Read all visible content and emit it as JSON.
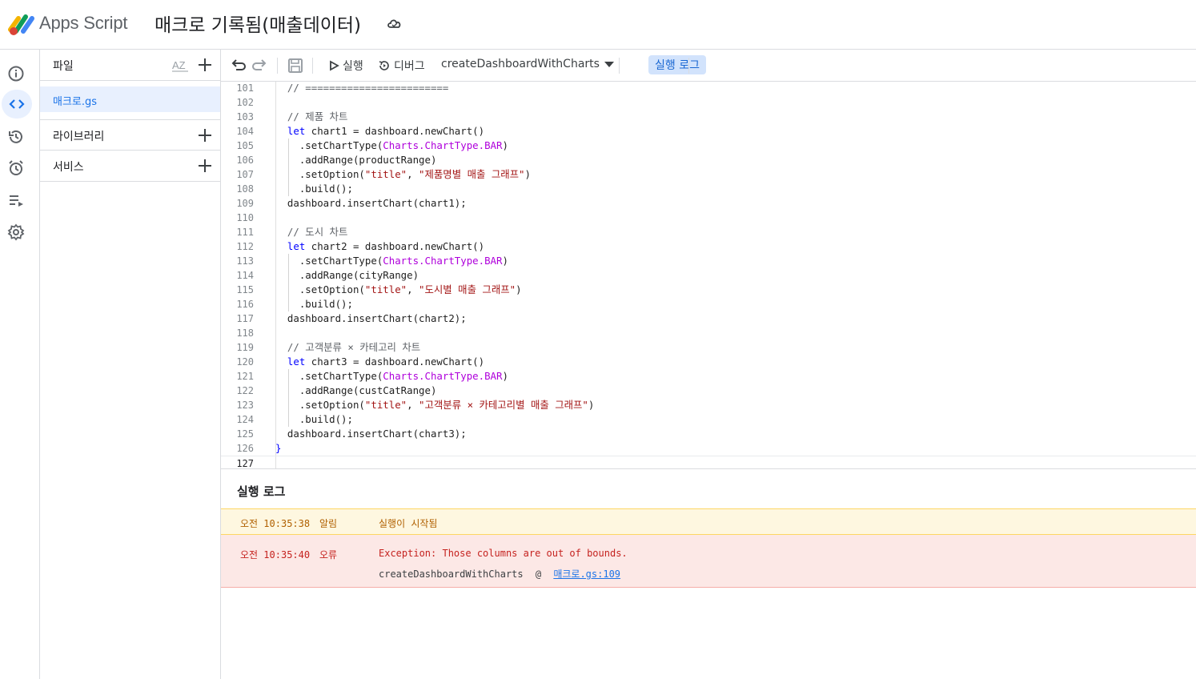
{
  "header": {
    "app_name": "Apps Script",
    "project_title": "매크로 기록됨(매출데이터)"
  },
  "rail": {
    "items": [
      "overview-icon",
      "editor-icon",
      "history-icon",
      "triggers-icon",
      "executions-icon",
      "settings-icon"
    ],
    "active": "editor-icon"
  },
  "files": {
    "section_label": "파일",
    "items": [
      {
        "label": "매크로.gs"
      }
    ],
    "libraries_label": "라이브러리",
    "services_label": "서비스"
  },
  "toolbar": {
    "run_label": "실행",
    "debug_label": "디버그",
    "function_selected": "createDashboardWithCharts",
    "log_button_label": "실행 로그"
  },
  "editor": {
    "lines": [
      {
        "n": "101",
        "text": "  // ========================"
      },
      {
        "n": "102",
        "text": ""
      },
      {
        "n": "103",
        "text": "  // 제품 차트"
      },
      {
        "n": "104",
        "text": "  let chart1 = dashboard.newChart()"
      },
      {
        "n": "105",
        "text": "    .setChartType(Charts.ChartType.BAR)"
      },
      {
        "n": "106",
        "text": "    .addRange(productRange)"
      },
      {
        "n": "107",
        "text": "    .setOption(\"title\", \"제품명별 매출 그래프\")"
      },
      {
        "n": "108",
        "text": "    .build();"
      },
      {
        "n": "109",
        "text": "  dashboard.insertChart(chart1);"
      },
      {
        "n": "110",
        "text": ""
      },
      {
        "n": "111",
        "text": "  // 도시 차트"
      },
      {
        "n": "112",
        "text": "  let chart2 = dashboard.newChart()"
      },
      {
        "n": "113",
        "text": "    .setChartType(Charts.ChartType.BAR)"
      },
      {
        "n": "114",
        "text": "    .addRange(cityRange)"
      },
      {
        "n": "115",
        "text": "    .setOption(\"title\", \"도시별 매출 그래프\")"
      },
      {
        "n": "116",
        "text": "    .build();"
      },
      {
        "n": "117",
        "text": "  dashboard.insertChart(chart2);"
      },
      {
        "n": "118",
        "text": ""
      },
      {
        "n": "119",
        "text": "  // 고객분류 × 카테고리 차트"
      },
      {
        "n": "120",
        "text": "  let chart3 = dashboard.newChart()"
      },
      {
        "n": "121",
        "text": "    .setChartType(Charts.ChartType.BAR)"
      },
      {
        "n": "122",
        "text": "    .addRange(custCatRange)"
      },
      {
        "n": "123",
        "text": "    .setOption(\"title\", \"고객분류 × 카테고리별 매출 그래프\")"
      },
      {
        "n": "124",
        "text": "    .build();"
      },
      {
        "n": "125",
        "text": "  dashboard.insertChart(chart3);"
      },
      {
        "n": "126",
        "text": "}"
      },
      {
        "n": "127",
        "text": ""
      }
    ]
  },
  "log": {
    "title": "실행 로그",
    "entries": [
      {
        "time": "오전 10:35:38",
        "level": "알림",
        "message": "실행이 시작됨"
      },
      {
        "time": "오전 10:35:40",
        "level": "오류",
        "message": "Exception: Those columns are out of bounds.",
        "trace_fn": "createDashboardWithCharts",
        "trace_at": "@",
        "trace_link": "매크로.gs:109"
      }
    ]
  },
  "colors": {
    "accent": "#1a73e8",
    "notice_bg": "#fef7e0",
    "error_bg": "#fce8e6",
    "keyword": "#0000ff",
    "string": "#a31515",
    "namespace": "#af00db"
  }
}
